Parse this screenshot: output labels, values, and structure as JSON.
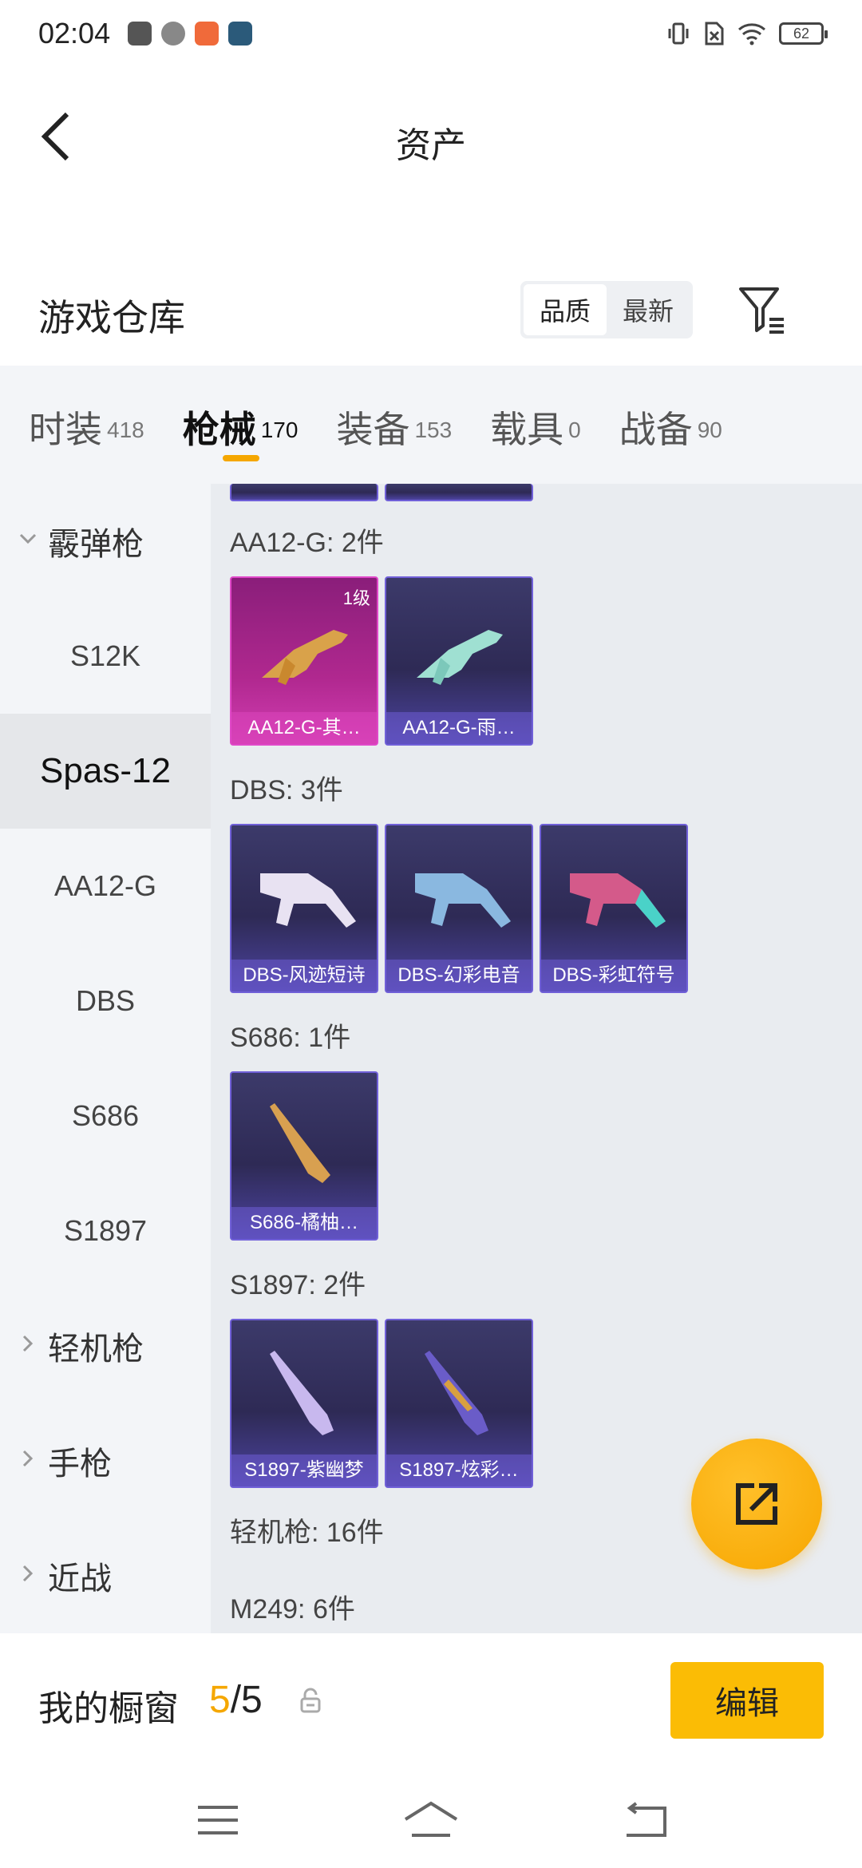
{
  "status": {
    "time": "02:04",
    "battery": "62"
  },
  "topbar": {
    "title": "资产"
  },
  "warehouse": {
    "title": "游戏仓库",
    "sort_options": [
      "品质",
      "最新"
    ]
  },
  "tabs": [
    {
      "label": "时装",
      "count": "418"
    },
    {
      "label": "枪械",
      "count": "170"
    },
    {
      "label": "装备",
      "count": "153"
    },
    {
      "label": "载具",
      "count": "0"
    },
    {
      "label": "战备",
      "count": "90"
    }
  ],
  "sidebar": [
    {
      "label": "霰弹枪",
      "type": "group",
      "expanded": true
    },
    {
      "label": "S12K",
      "type": "item"
    },
    {
      "label": "Spas-12",
      "type": "item",
      "active": true
    },
    {
      "label": "AA12-G",
      "type": "item"
    },
    {
      "label": "DBS",
      "type": "item"
    },
    {
      "label": "S686",
      "type": "item"
    },
    {
      "label": "S1897",
      "type": "item"
    },
    {
      "label": "轻机枪",
      "type": "group"
    },
    {
      "label": "手枪",
      "type": "group"
    },
    {
      "label": "近战",
      "type": "group"
    }
  ],
  "sections": [
    {
      "title": "AA12-G: 2件",
      "items": [
        {
          "name": "AA12-G-其…",
          "level": "1级",
          "rarity": "pink"
        },
        {
          "name": "AA12-G-雨…",
          "rarity": "purple"
        }
      ]
    },
    {
      "title": "DBS: 3件",
      "items": [
        {
          "name": "DBS-风迹短诗",
          "rarity": "purple"
        },
        {
          "name": "DBS-幻彩电音",
          "rarity": "purple"
        },
        {
          "name": "DBS-彩虹符号",
          "rarity": "purple"
        }
      ]
    },
    {
      "title": "S686: 1件",
      "items": [
        {
          "name": "S686-橘柚…",
          "rarity": "purple"
        }
      ]
    },
    {
      "title": "S1897: 2件",
      "items": [
        {
          "name": "S1897-紫幽梦",
          "rarity": "purple"
        },
        {
          "name": "S1897-炫彩…",
          "rarity": "purple"
        }
      ]
    },
    {
      "title": "轻机枪: 16件",
      "items": []
    },
    {
      "title": "M249: 6件",
      "items": []
    }
  ],
  "showcase": {
    "title": "我的橱窗",
    "current": "5",
    "separator": "/",
    "total": "5",
    "edit_label": "编辑"
  },
  "colors": {
    "accent": "#f5a700",
    "edit_button": "#fbbc05",
    "purple_card": "#3c3a6a",
    "pink_card": "#b0288f"
  }
}
